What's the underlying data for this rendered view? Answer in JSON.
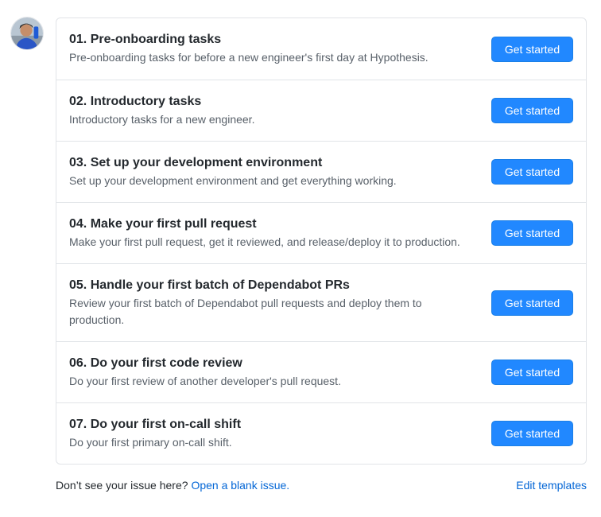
{
  "avatar": {
    "icon": "user-avatar"
  },
  "templates": [
    {
      "title": "01. Pre-onboarding tasks",
      "description": "Pre-onboarding tasks for before a new engineer's first day at Hypothesis.",
      "button": "Get started"
    },
    {
      "title": "02. Introductory tasks",
      "description": "Introductory tasks for a new engineer.",
      "button": "Get started"
    },
    {
      "title": "03. Set up your development environment",
      "description": "Set up your development environment and get everything working.",
      "button": "Get started"
    },
    {
      "title": "04. Make your first pull request",
      "description": "Make your first pull request, get it reviewed, and release/deploy it to production.",
      "button": "Get started"
    },
    {
      "title": "05. Handle your first batch of Dependabot PRs",
      "description": "Review your first batch of Dependabot pull requests and deploy them to production.",
      "button": "Get started"
    },
    {
      "title": "06. Do your first code review",
      "description": "Do your first review of another developer's pull request.",
      "button": "Get started"
    },
    {
      "title": "07. Do your first on-call shift",
      "description": "Do your first primary on-call shift.",
      "button": "Get started"
    }
  ],
  "footer": {
    "prompt": "Don’t see your issue here?",
    "blank_issue_link": "Open a blank issue.",
    "edit_templates_link": "Edit templates"
  },
  "colors": {
    "primary_button": "#2188ff",
    "link": "#0366d6",
    "border": "#e1e4e8"
  }
}
